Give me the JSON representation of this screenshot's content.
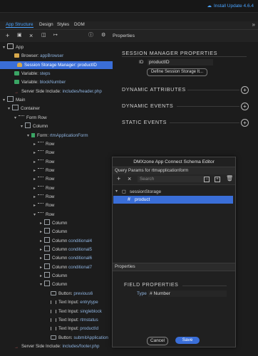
{
  "topbar": {
    "update_label": "Install Update 4.6.4"
  },
  "tabs": [
    {
      "label": "App Structure",
      "active": true
    },
    {
      "label": "Design"
    },
    {
      "label": "Styles"
    },
    {
      "label": "DOM"
    }
  ],
  "collapse_icon": "chevrons-right-icon",
  "toolbar": {
    "icons": [
      "add-icon",
      "add-child-icon",
      "delete-icon",
      "wrap-icon",
      "move-out-icon",
      "help-icon",
      "settings-icon"
    ],
    "properties_title": "Properties"
  },
  "tree": [
    {
      "label": "App",
      "value": "",
      "icon": "app"
    },
    {
      "label": "Browser:",
      "value": "appBrowser",
      "icon": "folder"
    },
    {
      "label": "Session Storage Manager:",
      "value": "productID",
      "icon": "db",
      "selected": true
    },
    {
      "label": "Variable:",
      "value": "steps",
      "icon": "var"
    },
    {
      "label": "Variable:",
      "value": "blockNumber",
      "icon": "var"
    },
    {
      "label": "Server Side Include:",
      "value": "includes/header.php",
      "icon": "arrow"
    },
    {
      "label": "Main",
      "value": "",
      "icon": "box"
    },
    {
      "label": "Container",
      "value": "",
      "icon": "box"
    },
    {
      "label": "Form Row",
      "value": "",
      "icon": "row"
    },
    {
      "label": "Column",
      "value": "",
      "icon": "col"
    },
    {
      "label": "Form:",
      "value": "rtmApplicationForm",
      "icon": "form"
    },
    {
      "label": "Row",
      "value": "",
      "icon": "row"
    },
    {
      "label": "Row",
      "value": "",
      "icon": "row"
    },
    {
      "label": "Row",
      "value": "",
      "icon": "row"
    },
    {
      "label": "Row",
      "value": "",
      "icon": "row"
    },
    {
      "label": "Row",
      "value": "",
      "icon": "row"
    },
    {
      "label": "Row",
      "value": "",
      "icon": "row"
    },
    {
      "label": "Row",
      "value": "",
      "icon": "row"
    },
    {
      "label": "Row",
      "value": "",
      "icon": "row"
    },
    {
      "label": "Row",
      "value": "",
      "icon": "row"
    },
    {
      "label": "Column",
      "value": "",
      "icon": "col"
    },
    {
      "label": "Column",
      "value": "",
      "icon": "col"
    },
    {
      "label": "Column",
      "value": "conditional4",
      "icon": "col"
    },
    {
      "label": "Column",
      "value": "conditional5",
      "icon": "col"
    },
    {
      "label": "Column",
      "value": "conditional6",
      "icon": "col"
    },
    {
      "label": "Column",
      "value": "conditional7",
      "icon": "col"
    },
    {
      "label": "Column",
      "value": "",
      "icon": "col"
    },
    {
      "label": "Column",
      "value": "",
      "icon": "col"
    },
    {
      "label": "Button:",
      "value": "previous6",
      "icon": "btn"
    },
    {
      "label": "Text Input:",
      "value": "entrytype",
      "icon": "input"
    },
    {
      "label": "Text Input:",
      "value": "singleblock",
      "icon": "input"
    },
    {
      "label": "Text Input:",
      "value": "rtmstatus",
      "icon": "input"
    },
    {
      "label": "Text Input:",
      "value": "productId",
      "icon": "input"
    },
    {
      "label": "Button:",
      "value": "submitApplication",
      "icon": "btn"
    },
    {
      "label": "Server Side Include:",
      "value": "includes/footer.php",
      "icon": "arrow"
    }
  ],
  "properties": {
    "section_title": "SESSION MANAGER PROPERTIES",
    "id_label": "ID",
    "id_value": "productID",
    "define_button": "Define Session Storage It...",
    "sections": [
      "DYNAMIC ATTRIBUTES",
      "DYNAMIC EVENTS",
      "STATIC EVENTS"
    ]
  },
  "modal": {
    "title": "DMXzone App Connect Schema Editor",
    "subtitle": "Query Params for rtmapplicationform",
    "search_placeholder": "Search",
    "root_node": "sessionStorage",
    "child_node": "product",
    "properties_title": "Properties",
    "field_section": "FIELD PROPERTIES",
    "type_label": "Type",
    "type_value": "Number",
    "cancel_label": "Cancel",
    "save_label": "Save"
  },
  "colors": {
    "accent": "#3a6ed8",
    "link": "#4aa3ff",
    "panel": "#1c1c1c"
  }
}
